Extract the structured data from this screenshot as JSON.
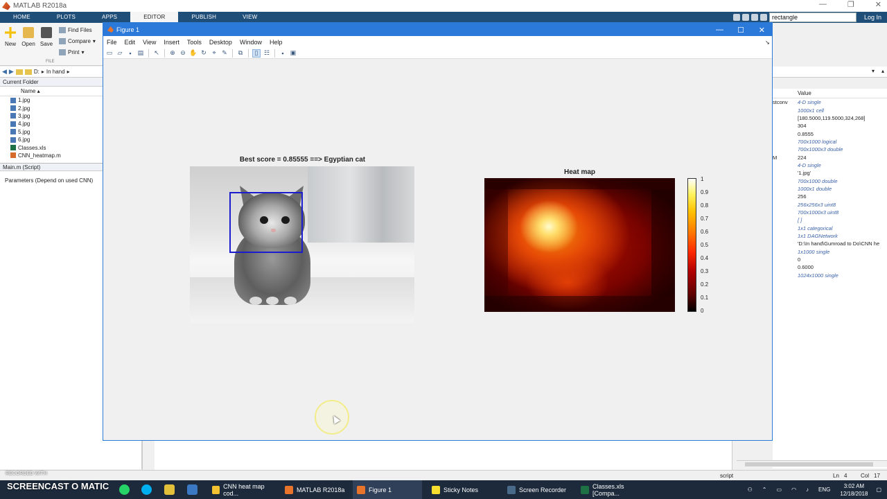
{
  "matlab": {
    "title": "MATLAB R2018a",
    "tabs": [
      "HOME",
      "PLOTS",
      "APPS",
      "EDITOR",
      "PUBLISH",
      "VIEW"
    ],
    "active_tab": "EDITOR",
    "search_value": "rectangle",
    "login": "Log In"
  },
  "ribbon": {
    "new": "New",
    "open": "Open",
    "save": "Save",
    "find_files": "Find Files",
    "compare": "Compare",
    "print": "Print",
    "section": "FILE"
  },
  "address": {
    "drive": "D:",
    "folder": "In hand"
  },
  "current_folder": {
    "header": "Current Folder",
    "name_col": "Name",
    "files": [
      {
        "name": "1.jpg",
        "type": "img"
      },
      {
        "name": "2.jpg",
        "type": "img"
      },
      {
        "name": "3.jpg",
        "type": "img"
      },
      {
        "name": "4.jpg",
        "type": "img"
      },
      {
        "name": "5.jpg",
        "type": "img"
      },
      {
        "name": "6.jpg",
        "type": "img"
      },
      {
        "name": "Classes.xls",
        "type": "xls"
      },
      {
        "name": "CNN_heatmap.m",
        "type": "m"
      }
    ]
  },
  "details": {
    "header": "Main.m  (Script)",
    "text": "Parameters (Depend on used CNN)"
  },
  "figure": {
    "title": "Figure 1",
    "menu": [
      "File",
      "Edit",
      "View",
      "Insert",
      "Tools",
      "Desktop",
      "Window",
      "Help"
    ],
    "left_plot_title": "Best score = 0.85555 ==> Egyptian cat",
    "right_plot_title": "Heat map",
    "colorbar_ticks": [
      "1",
      "0.9",
      "0.8",
      "0.7",
      "0.6",
      "0.5",
      "0.4",
      "0.3",
      "0.2",
      "0.1",
      "0"
    ]
  },
  "workspace": {
    "value_header": "Value",
    "rows": [
      {
        "name": "stconv",
        "value": "4-D single",
        "italic": true
      },
      {
        "name": "",
        "value": "1000x1 cell",
        "italic": true
      },
      {
        "name": "",
        "value": "[180.5000,119.5000,324,268]",
        "italic": false
      },
      {
        "name": "",
        "value": "304",
        "italic": false
      },
      {
        "name": "",
        "value": "0.8555",
        "italic": false
      },
      {
        "name": "",
        "value": "700x1000 logical",
        "italic": true
      },
      {
        "name": "",
        "value": "700x1000x3 double",
        "italic": true
      },
      {
        "name": "M",
        "value": "224",
        "italic": false
      },
      {
        "name": "",
        "value": "4-D single",
        "italic": true
      },
      {
        "name": "",
        "value": "'1.jpg'",
        "italic": false
      },
      {
        "name": "",
        "value": "700x1000 double",
        "italic": true
      },
      {
        "name": "",
        "value": "1000x1 double",
        "italic": true
      },
      {
        "name": "",
        "value": "256",
        "italic": false
      },
      {
        "name": "",
        "value": "256x256x3 uint8",
        "italic": true
      },
      {
        "name": "",
        "value": "700x1000x3 uint8",
        "italic": true
      },
      {
        "name": "",
        "value": "[ ]",
        "italic": true
      },
      {
        "name": "",
        "value": "1x1 categorical",
        "italic": true
      },
      {
        "name": "",
        "value": "1x1 DAGNetwork",
        "italic": true
      },
      {
        "name": "",
        "value": "'D:\\In hand\\Gumroad to Do\\CNN he",
        "italic": false
      },
      {
        "name": "",
        "value": "1x1000 single",
        "italic": true
      },
      {
        "name": "",
        "value": "0",
        "italic": false
      },
      {
        "name": "",
        "value": "0.6000",
        "italic": false
      },
      {
        "name": "",
        "value": "1024x1000 single",
        "italic": true
      }
    ]
  },
  "status": {
    "mode": "script",
    "ln": "Ln",
    "ln_val": "4",
    "col": "Col",
    "col_val": "17"
  },
  "taskbar": {
    "items": [
      {
        "label": "CNN heat map cod...",
        "color": "#f2c230"
      },
      {
        "label": "MATLAB R2018a",
        "color": "#e8742c"
      },
      {
        "label": "Figure 1",
        "color": "#e8742c",
        "active": true
      },
      {
        "label": "Sticky Notes",
        "color": "#f7dd2e"
      },
      {
        "label": "Screen Recorder",
        "color": "#4a6a8a"
      },
      {
        "label": "Classes.xls  [Compa...",
        "color": "#1e7145"
      }
    ],
    "lang": "ENG",
    "time": "3:02 AM",
    "date": "12/18/2018",
    "watermark_top": "RECORDED WITH",
    "watermark_brand": "SCREENCAST O MATIC"
  }
}
